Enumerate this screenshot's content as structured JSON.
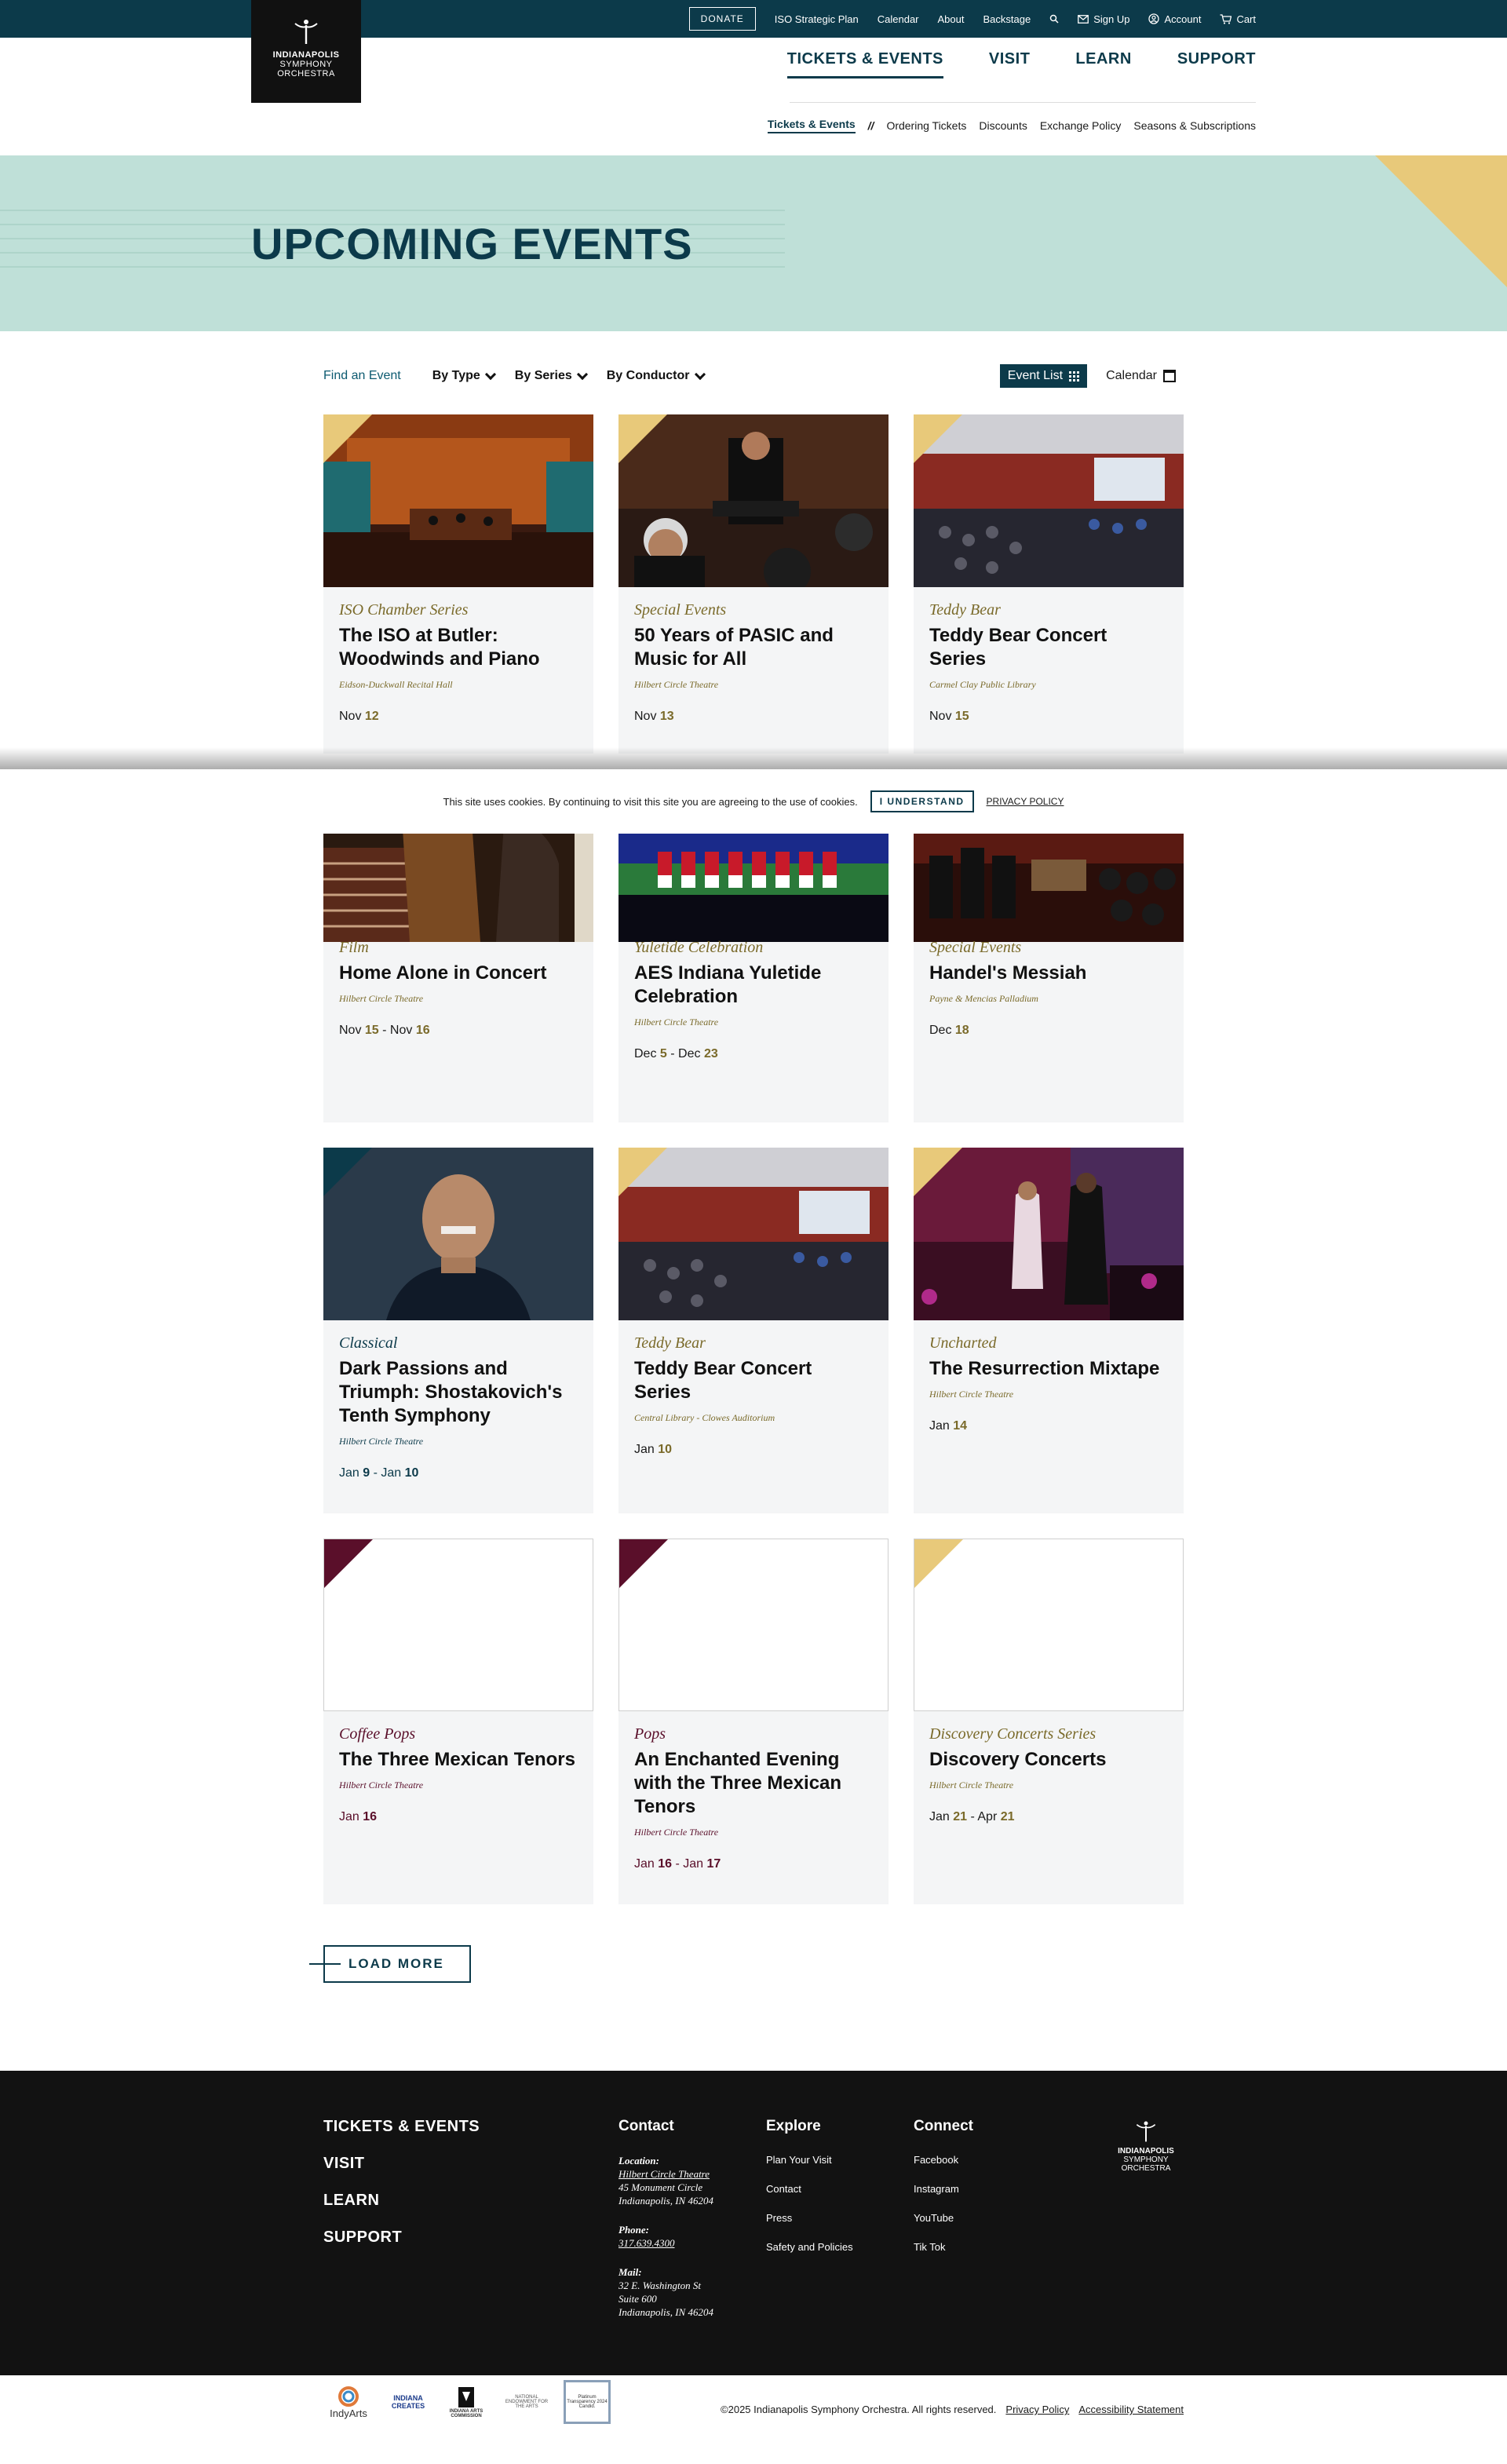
{
  "utility": {
    "donate": "DONATE",
    "links": [
      "ISO Strategic Plan",
      "Calendar",
      "About",
      "Backstage"
    ],
    "sign_up": "Sign Up",
    "account": "Account",
    "cart": "Cart"
  },
  "logo": {
    "line1": "INDIANAPOLIS",
    "line2": "SYMPHONY",
    "line3": "ORCHESTRA"
  },
  "main_nav": [
    "TICKETS & EVENTS",
    "VISIT",
    "LEARN",
    "SUPPORT"
  ],
  "sub_nav": {
    "active": "Tickets & Events",
    "separator": "//",
    "items": [
      "Ordering Tickets",
      "Discounts",
      "Exchange Policy",
      "Seasons & Subscriptions"
    ]
  },
  "hero": {
    "title": "UPCOMING EVENTS"
  },
  "filters": {
    "find": "Find an Event",
    "by_type": "By Type",
    "by_series": "By Series",
    "by_conductor": "By Conductor",
    "event_list": "Event List",
    "calendar": "Calendar"
  },
  "events": [
    {
      "category": "ISO Chamber Series",
      "title": "The ISO at Butler: Woodwinds and Piano",
      "venue": "Eidson-Duckwall Recital Hall",
      "date_pre": "Nov ",
      "date_b": "12",
      "date_mid": "",
      "date_b2": "",
      "flag": "#e8c97a",
      "accent": "#7a6a2a"
    },
    {
      "category": "Special Events",
      "title": "50 Years of PASIC and Music for All",
      "venue": "Hilbert Circle Theatre",
      "date_pre": "Nov ",
      "date_b": "13",
      "date_mid": "",
      "date_b2": "",
      "flag": "#e8c97a",
      "accent": "#7a6a2a"
    },
    {
      "category": "Teddy Bear",
      "title": "Teddy Bear Concert Series",
      "venue": "Carmel Clay Public Library",
      "date_pre": "Nov ",
      "date_b": "15",
      "date_mid": "",
      "date_b2": "",
      "flag": "#e8c97a",
      "accent": "#7a6a2a"
    },
    {
      "category": "Film",
      "title": "Home Alone in Concert",
      "venue": "Hilbert Circle Theatre",
      "date_pre": "Nov ",
      "date_b": "15",
      "date_mid": " - Nov ",
      "date_b2": "16",
      "flag": "",
      "accent": "#7a6a2a"
    },
    {
      "category": "Yuletide Celebration",
      "title": "AES Indiana Yuletide Celebration",
      "venue": "Hilbert Circle Theatre",
      "date_pre": "Dec ",
      "date_b": "5",
      "date_mid": " - Dec ",
      "date_b2": "23",
      "flag": "",
      "accent": "#7a6a2a"
    },
    {
      "category": "Special Events",
      "title": "Handel's Messiah",
      "venue": "Payne & Mencias Palladium",
      "date_pre": "Dec ",
      "date_b": "18",
      "date_mid": "",
      "date_b2": "",
      "flag": "",
      "accent": "#7a6a2a"
    },
    {
      "category": "Classical",
      "title": "Dark Passions and Triumph: Shostakovich's Tenth Symphony",
      "venue": "Hilbert Circle Theatre",
      "date_pre": "Jan ",
      "date_b": "9",
      "date_mid": " - Jan ",
      "date_b2": "10",
      "flag": "#0c3a4a",
      "accent": "#0c3a4a"
    },
    {
      "category": "Teddy Bear",
      "title": "Teddy Bear Concert Series",
      "venue": "Central Library - Clowes Auditorium",
      "date_pre": "Jan ",
      "date_b": "10",
      "date_mid": "",
      "date_b2": "",
      "flag": "#e8c97a",
      "accent": "#7a6a2a"
    },
    {
      "category": "Uncharted",
      "title": "The Resurrection Mixtape",
      "venue": "Hilbert Circle Theatre",
      "date_pre": "Jan ",
      "date_b": "14",
      "date_mid": "",
      "date_b2": "",
      "flag": "#e8c97a",
      "accent": "#7a6a2a"
    },
    {
      "category": "Coffee Pops",
      "title": "The Three Mexican Tenors",
      "venue": "Hilbert Circle Theatre",
      "date_pre": "Jan ",
      "date_b": "16",
      "date_mid": "",
      "date_b2": "",
      "flag": "#5a0f2a",
      "accent": "#5a0f2a"
    },
    {
      "category": "Pops",
      "title": "An Enchanted Evening with the Three Mexican Tenors",
      "venue": "Hilbert Circle Theatre",
      "date_pre": "Jan ",
      "date_b": "16",
      "date_mid": " - Jan ",
      "date_b2": "17",
      "flag": "#5a0f2a",
      "accent": "#5a0f2a"
    },
    {
      "category": "Discovery Concerts Series",
      "title": "Discovery Concerts",
      "venue": "Hilbert Circle Theatre",
      "date_pre": "Jan ",
      "date_b": "21",
      "date_mid": " - Apr ",
      "date_b2": "21",
      "flag": "#e8c97a",
      "accent": "#7a6a2a"
    }
  ],
  "cookie": {
    "text": "This site uses cookies. By continuing to visit this site you are agreeing to the use of cookies.",
    "button": "I UNDERSTAND",
    "policy": "PRIVACY POLICY"
  },
  "load_more": "LOAD MORE",
  "footer": {
    "nav": [
      "TICKETS & EVENTS",
      "VISIT",
      "LEARN",
      "SUPPORT"
    ],
    "contact": {
      "heading": "Contact",
      "location_label": "Location:",
      "location_name": "Hilbert Circle Theatre",
      "location_addr1": "45 Monument Circle",
      "location_addr2": "Indianapolis, IN 46204",
      "phone_label": "Phone:",
      "phone": "317.639.4300",
      "mail_label": "Mail:",
      "mail_addr1": "32 E. Washington St",
      "mail_addr2": "Suite 600",
      "mail_addr3": "Indianapolis, IN 46204"
    },
    "explore": {
      "heading": "Explore",
      "items": [
        "Plan Your Visit",
        "Contact",
        "Press",
        "Safety and Policies"
      ]
    },
    "connect": {
      "heading": "Connect",
      "items": [
        "Facebook",
        "Instagram",
        "YouTube",
        "Tik Tok"
      ]
    },
    "logo": {
      "line1": "INDIANAPOLIS",
      "line2": "SYMPHONY",
      "line3": "ORCHESTRA"
    }
  },
  "bottom": {
    "sponsors": [
      "IndyArts",
      "INDIANA CREATES",
      "INDIANA ARTS COMMISSION",
      "NATIONAL ENDOWMENT FOR THE ARTS",
      "Platinum Transparency 2024 Candid."
    ],
    "copyright": "©2025 Indianapolis Symphony Orchestra. All rights reserved.",
    "privacy": "Privacy Policy",
    "accessibility": "Accessibility Statement"
  },
  "colors": {
    "brand": "#0c3a4a",
    "hero_bg": "#bfe0d8",
    "gold": "#e8c97a",
    "footer_bg": "#121212"
  }
}
